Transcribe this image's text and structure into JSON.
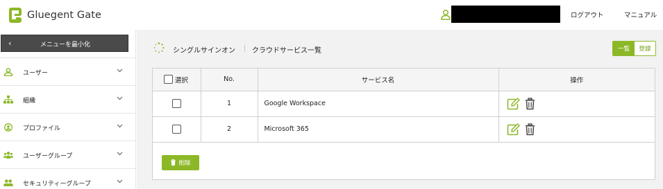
{
  "app": {
    "title": "Gluegent Gate"
  },
  "header": {
    "logout_label": "ログアウト",
    "manual_label": "マニュアル",
    "user_name": ""
  },
  "sidebar": {
    "minimize_label": "メニューを最小化",
    "items": [
      {
        "label": "ユーザー",
        "icon": "user-icon"
      },
      {
        "label": "組織",
        "icon": "org-chart-icon"
      },
      {
        "label": "プロファイル",
        "icon": "profile-icon"
      },
      {
        "label": "ユーザーグループ",
        "icon": "user-group-icon"
      },
      {
        "label": "セキュリティーグループ",
        "icon": "security-group-icon"
      }
    ]
  },
  "breadcrumb": {
    "section": "シングルサインオン",
    "separator": "|",
    "page": "クラウドサービス一覧"
  },
  "view_toggle": {
    "list_label": "一覧",
    "register_label": "登録"
  },
  "table": {
    "headers": {
      "select": "選択",
      "no": "No.",
      "name": "サービス名",
      "operation": "操作"
    },
    "rows": [
      {
        "no": "1",
        "name": "Google Workspace"
      },
      {
        "no": "2",
        "name": "Microsoft 365"
      }
    ]
  },
  "actions": {
    "delete_label": "削除"
  },
  "colors": {
    "accent": "#8cb828",
    "sidebar_button": "#4a4a4a",
    "content_bg": "#f2f2f2"
  }
}
